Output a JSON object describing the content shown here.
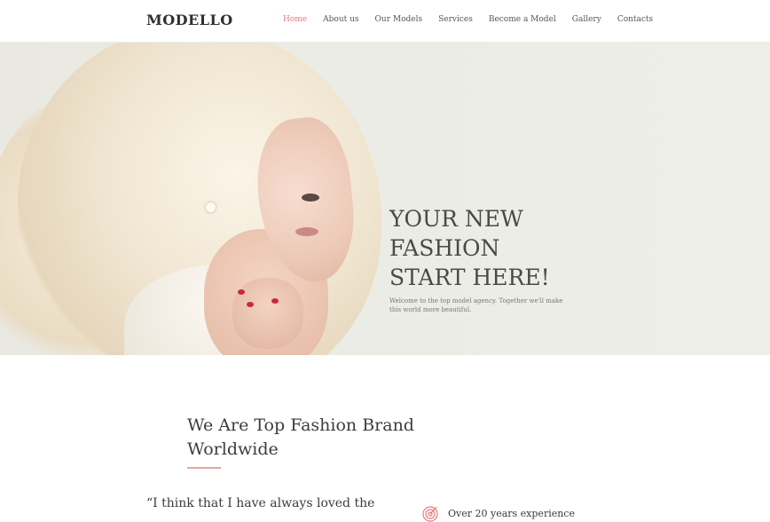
{
  "brand": {
    "logo": "MODELLO"
  },
  "nav": [
    {
      "label": "Home",
      "active": true
    },
    {
      "label": "About us",
      "active": false
    },
    {
      "label": "Our Models",
      "active": false
    },
    {
      "label": "Services",
      "active": false
    },
    {
      "label": "Become a Model",
      "active": false
    },
    {
      "label": "Gallery",
      "active": false
    },
    {
      "label": "Contacts",
      "active": false
    }
  ],
  "hero": {
    "title_line1": "YOUR NEW",
    "title_line2": "FASHION",
    "title_line3": "START HERE!",
    "subtitle": "Welcome to the top model agency. Together we'll make this world more beautiful."
  },
  "about": {
    "title": "We Are Top Fashion Brand Worldwide",
    "quote_start": "“I think that I have always loved the",
    "feature_text": "Over 20 years experience",
    "feature_icon": "target-icon"
  },
  "colors": {
    "accent": "#e07f81",
    "rule": "#e7a3a6"
  }
}
